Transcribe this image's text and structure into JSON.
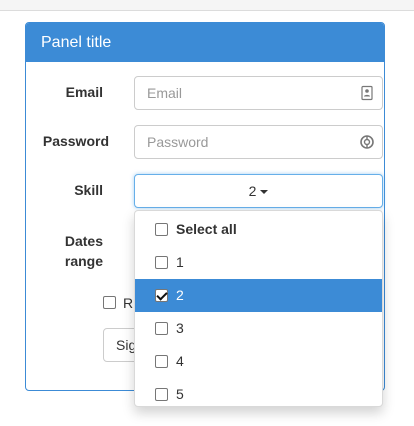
{
  "panel": {
    "title": "Panel title"
  },
  "form": {
    "email_label": "Email",
    "email_placeholder": "Email",
    "password_label": "Password",
    "password_placeholder": "Password",
    "skill_label": "Skill",
    "skill_selected": "2",
    "dates_label_line1": "Dates",
    "dates_label_line2": "range",
    "remember_text": "R",
    "signin_label": "Sig"
  },
  "dropdown": {
    "items": [
      {
        "label": "Select all",
        "checked": false,
        "active": false
      },
      {
        "label": "1",
        "checked": false,
        "active": false
      },
      {
        "label": "2",
        "checked": true,
        "active": true
      },
      {
        "label": "3",
        "checked": false,
        "active": false
      },
      {
        "label": "4",
        "checked": false,
        "active": false
      },
      {
        "label": "5",
        "checked": false,
        "active": false
      }
    ]
  },
  "icons": {
    "email": "contact-card-icon",
    "password": "lifebuoy-icon",
    "caret": "caret-down-icon"
  },
  "colors": {
    "primary": "#3c8bd6",
    "focus_border": "#66afe9",
    "border": "#cccccc",
    "placeholder": "#999999"
  }
}
